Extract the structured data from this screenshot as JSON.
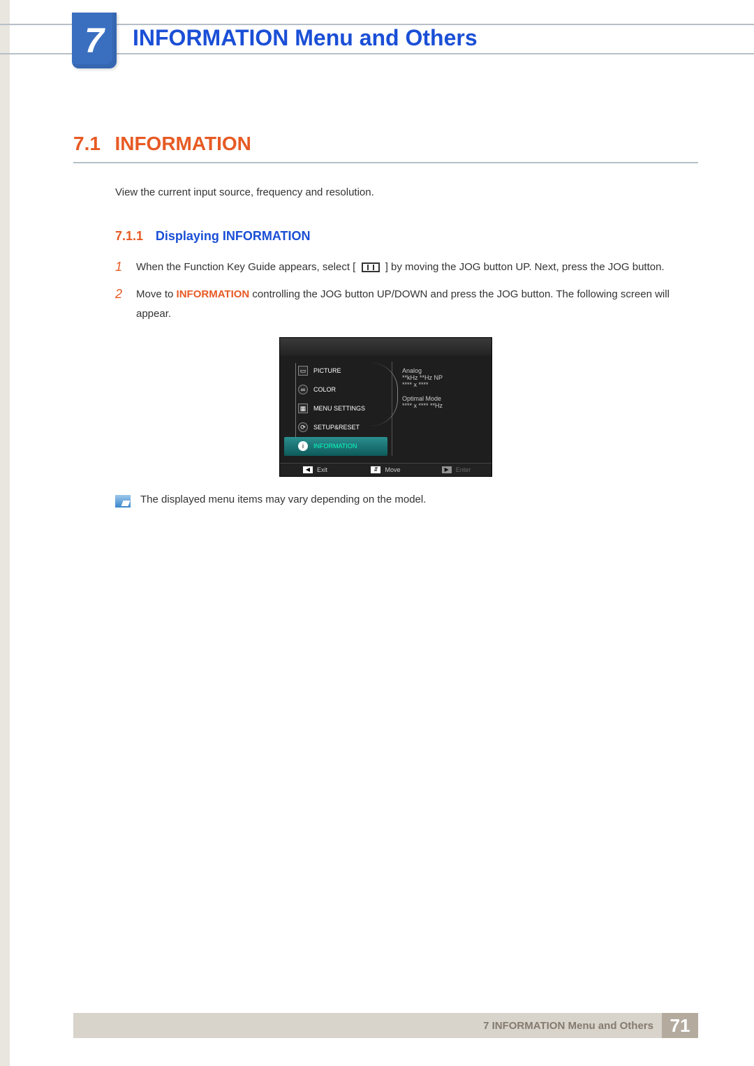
{
  "chapter": {
    "number": "7",
    "title": "INFORMATION Menu and Others"
  },
  "section": {
    "number": "7.1",
    "title": "INFORMATION",
    "intro": "View the current input source, frequency and resolution."
  },
  "subsection": {
    "number": "7.1.1",
    "title": "Displaying INFORMATION"
  },
  "steps": {
    "s1": {
      "num": "1",
      "pre": "When the Function Key Guide appears, select [",
      "post": "] by moving the JOG button UP. Next, press the JOG button."
    },
    "s2": {
      "num": "2",
      "a": "Move to ",
      "info": "INFORMATION",
      "b": " controlling the JOG button UP/DOWN and press the JOG button. The following screen will appear."
    }
  },
  "osd": {
    "items": {
      "picture": "PICTURE",
      "color": "COLOR",
      "menu_settings": "MENU SETTINGS",
      "setup_reset": "SETUP&RESET",
      "information": "INFORMATION"
    },
    "right": {
      "l1": "Analog",
      "l2": "**kHz  **Hz NP",
      "l3": "**** x ****",
      "l4": "Optimal Mode",
      "l5": "**** x ****  **Hz"
    },
    "bottom": {
      "exit": "Exit",
      "move": "Move",
      "enter": "Enter"
    }
  },
  "note": "The displayed menu items may vary depending on the model.",
  "footer": {
    "text": "7 INFORMATION Menu and Others",
    "page": "71"
  }
}
